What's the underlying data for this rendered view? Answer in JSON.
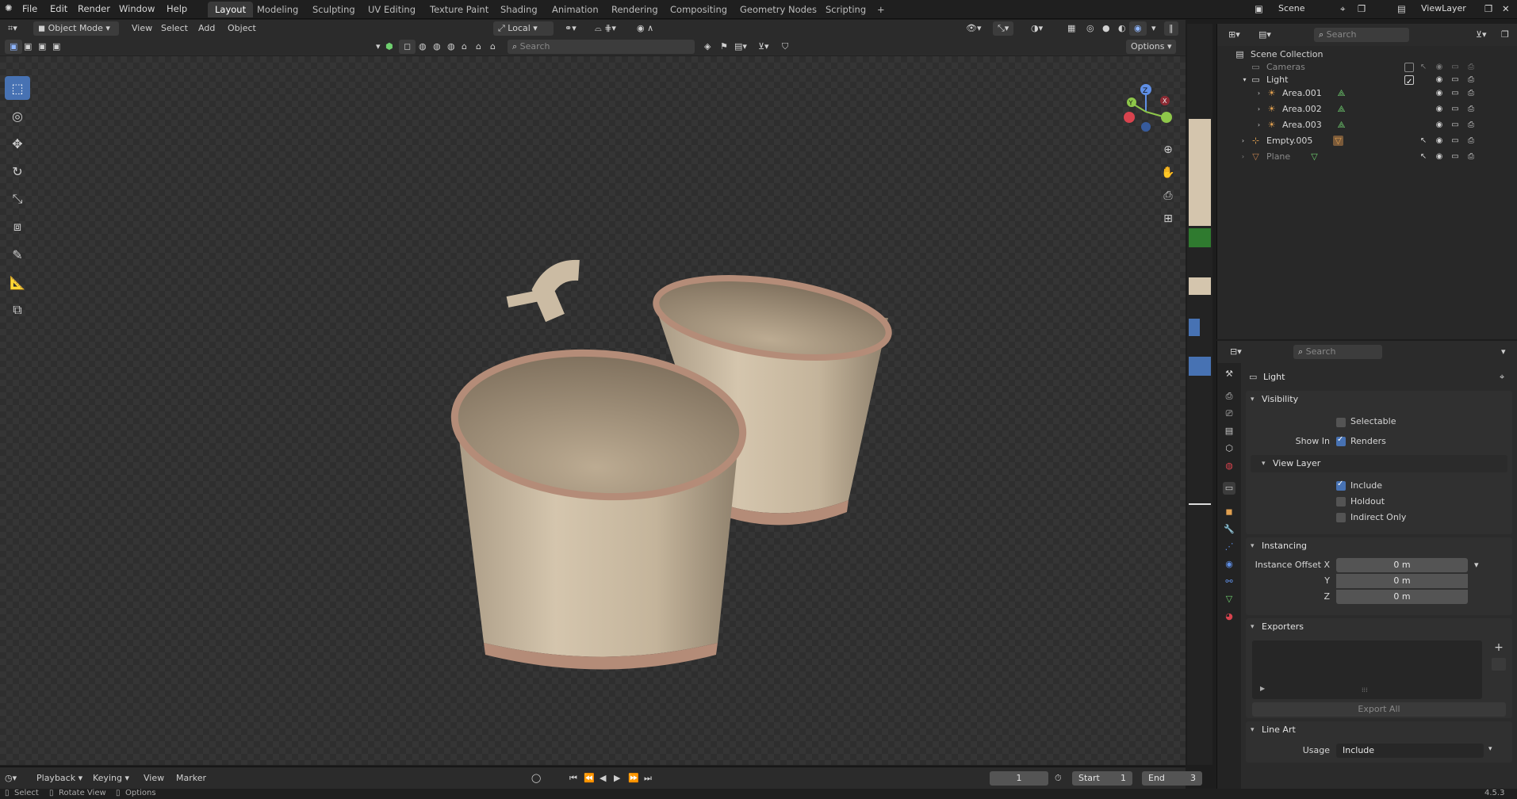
{
  "app": {
    "title": "Blender",
    "version": "4.5.3"
  },
  "menus": [
    "File",
    "Edit",
    "Render",
    "Window",
    "Help"
  ],
  "workspaces": [
    {
      "label": "Layout",
      "active": true
    },
    {
      "label": "Modeling"
    },
    {
      "label": "Sculpting"
    },
    {
      "label": "UV Editing"
    },
    {
      "label": "Texture Paint"
    },
    {
      "label": "Shading"
    },
    {
      "label": "Animation"
    },
    {
      "label": "Rendering"
    },
    {
      "label": "Compositing"
    },
    {
      "label": "Geometry Nodes"
    },
    {
      "label": "Scripting"
    }
  ],
  "scene": {
    "name": "Scene",
    "view_layer": "ViewLayer"
  },
  "viewport_header": {
    "mode": "Object Mode",
    "view": "View",
    "select": "Select",
    "add": "Add",
    "object": "Object",
    "orientation": "Local",
    "search_placeholder": "Search",
    "options": "Options"
  },
  "outliner": {
    "search_placeholder": "Search",
    "root": "Scene Collection",
    "rows": [
      {
        "label": "Cameras",
        "indent": 0
      },
      {
        "label": "Light",
        "indent": 0
      },
      {
        "label": "Area.001",
        "indent": 1
      },
      {
        "label": "Area.002",
        "indent": 1
      },
      {
        "label": "Area.003",
        "indent": 1
      },
      {
        "label": "Empty.005",
        "indent": 0
      },
      {
        "label": "Plane",
        "indent": 0
      }
    ]
  },
  "properties": {
    "search_placeholder": "Search",
    "context": "Light",
    "visibility": {
      "title": "Visibility",
      "selectable": "Selectable",
      "show_in": "Show In",
      "renders": "Renders",
      "view_layer": "View Layer",
      "include": "Include",
      "holdout": "Holdout",
      "indirect_only": "Indirect Only"
    },
    "instancing": {
      "title": "Instancing",
      "offset_x_label": "Instance Offset X",
      "y_label": "Y",
      "z_label": "Z",
      "x": "0 m",
      "y": "0 m",
      "z": "0 m"
    },
    "exporters": {
      "title": "Exporters",
      "export_all": "Export All"
    },
    "line_art": {
      "title": "Line Art",
      "usage_label": "Usage",
      "usage": "Include"
    }
  },
  "timeline": {
    "playback": "Playback",
    "keying": "Keying",
    "view": "View",
    "marker": "Marker",
    "current_frame": "1",
    "start_label": "Start",
    "start": "1",
    "end_label": "End",
    "end": "3"
  },
  "statusbar": {
    "select": "Select",
    "rotate": "Rotate View",
    "options": "Options"
  },
  "colors": {
    "accent": "#4772b3",
    "mug": "#cbbba3",
    "mug_rim": "#b48c78"
  }
}
